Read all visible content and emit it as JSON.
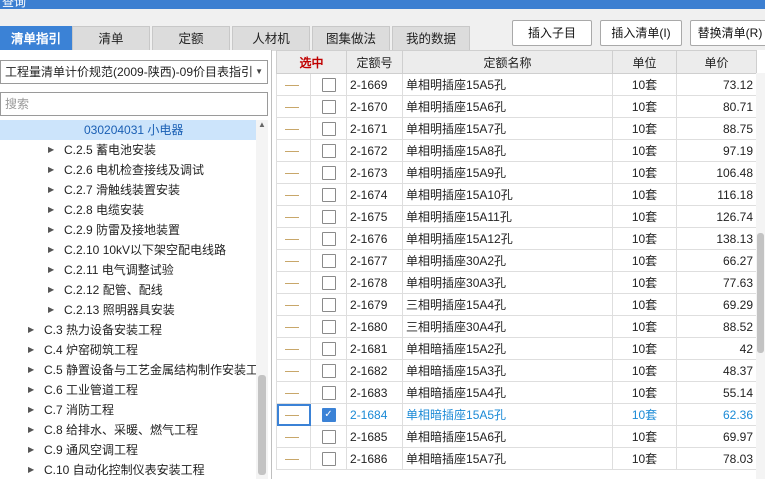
{
  "window": {
    "title": "查询"
  },
  "tabs": [
    {
      "label": "清单指引",
      "active": true
    },
    {
      "label": "清单",
      "active": false
    },
    {
      "label": "定额",
      "active": false
    },
    {
      "label": "人材机",
      "active": false
    },
    {
      "label": "图集做法",
      "active": false
    },
    {
      "label": "我的数据",
      "active": false
    }
  ],
  "toolbar": {
    "insert_child": "插入子目",
    "insert_list": "插入清单(I)",
    "replace_list": "替换清单(R)"
  },
  "left_panel": {
    "spec_select": "工程量清单计价规范(2009-陕西)-09价目表指引",
    "search_placeholder": "搜索",
    "tree": [
      {
        "label": "030204031  小电器",
        "level": 2,
        "selected": true,
        "arrow": false
      },
      {
        "label": "C.2.5  蓄电池安装",
        "level": 1,
        "arrow": true
      },
      {
        "label": "C.2.6  电机检查接线及调试",
        "level": 1,
        "arrow": true
      },
      {
        "label": "C.2.7  滑触线装置安装",
        "level": 1,
        "arrow": true
      },
      {
        "label": "C.2.8  电缆安装",
        "level": 1,
        "arrow": true
      },
      {
        "label": "C.2.9  防雷及接地装置",
        "level": 1,
        "arrow": true
      },
      {
        "label": "C.2.10  10kV以下架空配电线路",
        "level": 1,
        "arrow": true
      },
      {
        "label": "C.2.11  电气调整试验",
        "level": 1,
        "arrow": true
      },
      {
        "label": "C.2.12  配管、配线",
        "level": 1,
        "arrow": true
      },
      {
        "label": "C.2.13  照明器具安装",
        "level": 1,
        "arrow": true
      },
      {
        "label": "C.3  热力设备安装工程",
        "level": 0,
        "arrow": true
      },
      {
        "label": "C.4  炉窑砌筑工程",
        "level": 0,
        "arrow": true
      },
      {
        "label": "C.5  静置设备与工艺金属结构制作安装工程",
        "level": 0,
        "arrow": true
      },
      {
        "label": "C.6  工业管道工程",
        "level": 0,
        "arrow": true
      },
      {
        "label": "C.7 消防工程",
        "level": 0,
        "arrow": true
      },
      {
        "label": "C.8  给排水、采暖、燃气工程",
        "level": 0,
        "arrow": true
      },
      {
        "label": "C.9  通风空调工程",
        "level": 0,
        "arrow": true
      },
      {
        "label": "C.10  自动化控制仪表安装工程",
        "level": 0,
        "arrow": true
      }
    ]
  },
  "grid": {
    "columns": [
      "选中",
      "定额号",
      "定额名称",
      "单位",
      "单价"
    ],
    "rows": [
      {
        "code": "2-1669",
        "name": "单相明插座15A5孔",
        "unit": "10套",
        "price": "73.12",
        "checked": false
      },
      {
        "code": "2-1670",
        "name": "单相明插座15A6孔",
        "unit": "10套",
        "price": "80.71",
        "checked": false
      },
      {
        "code": "2-1671",
        "name": "单相明插座15A7孔",
        "unit": "10套",
        "price": "88.75",
        "checked": false
      },
      {
        "code": "2-1672",
        "name": "单相明插座15A8孔",
        "unit": "10套",
        "price": "97.19",
        "checked": false
      },
      {
        "code": "2-1673",
        "name": "单相明插座15A9孔",
        "unit": "10套",
        "price": "106.48",
        "checked": false
      },
      {
        "code": "2-1674",
        "name": "单相明插座15A10孔",
        "unit": "10套",
        "price": "116.18",
        "checked": false
      },
      {
        "code": "2-1675",
        "name": "单相明插座15A11孔",
        "unit": "10套",
        "price": "126.74",
        "checked": false
      },
      {
        "code": "2-1676",
        "name": "单相明插座15A12孔",
        "unit": "10套",
        "price": "138.13",
        "checked": false
      },
      {
        "code": "2-1677",
        "name": "单相明插座30A2孔",
        "unit": "10套",
        "price": "66.27",
        "checked": false
      },
      {
        "code": "2-1678",
        "name": "单相明插座30A3孔",
        "unit": "10套",
        "price": "77.63",
        "checked": false
      },
      {
        "code": "2-1679",
        "name": "三相明插座15A4孔",
        "unit": "10套",
        "price": "69.29",
        "checked": false
      },
      {
        "code": "2-1680",
        "name": "三相明插座30A4孔",
        "unit": "10套",
        "price": "88.52",
        "checked": false
      },
      {
        "code": "2-1681",
        "name": "单相暗插座15A2孔",
        "unit": "10套",
        "price": "42",
        "checked": false
      },
      {
        "code": "2-1682",
        "name": "单相暗插座15A3孔",
        "unit": "10套",
        "price": "48.37",
        "checked": false
      },
      {
        "code": "2-1683",
        "name": "单相暗插座15A4孔",
        "unit": "10套",
        "price": "55.14",
        "checked": false
      },
      {
        "code": "2-1684",
        "name": "单相暗插座15A5孔",
        "unit": "10套",
        "price": "62.36",
        "checked": true
      },
      {
        "code": "2-1685",
        "name": "单相暗插座15A6孔",
        "unit": "10套",
        "price": "69.97",
        "checked": false
      },
      {
        "code": "2-1686",
        "name": "单相暗插座15A7孔",
        "unit": "10套",
        "price": "78.03",
        "checked": false
      }
    ]
  }
}
